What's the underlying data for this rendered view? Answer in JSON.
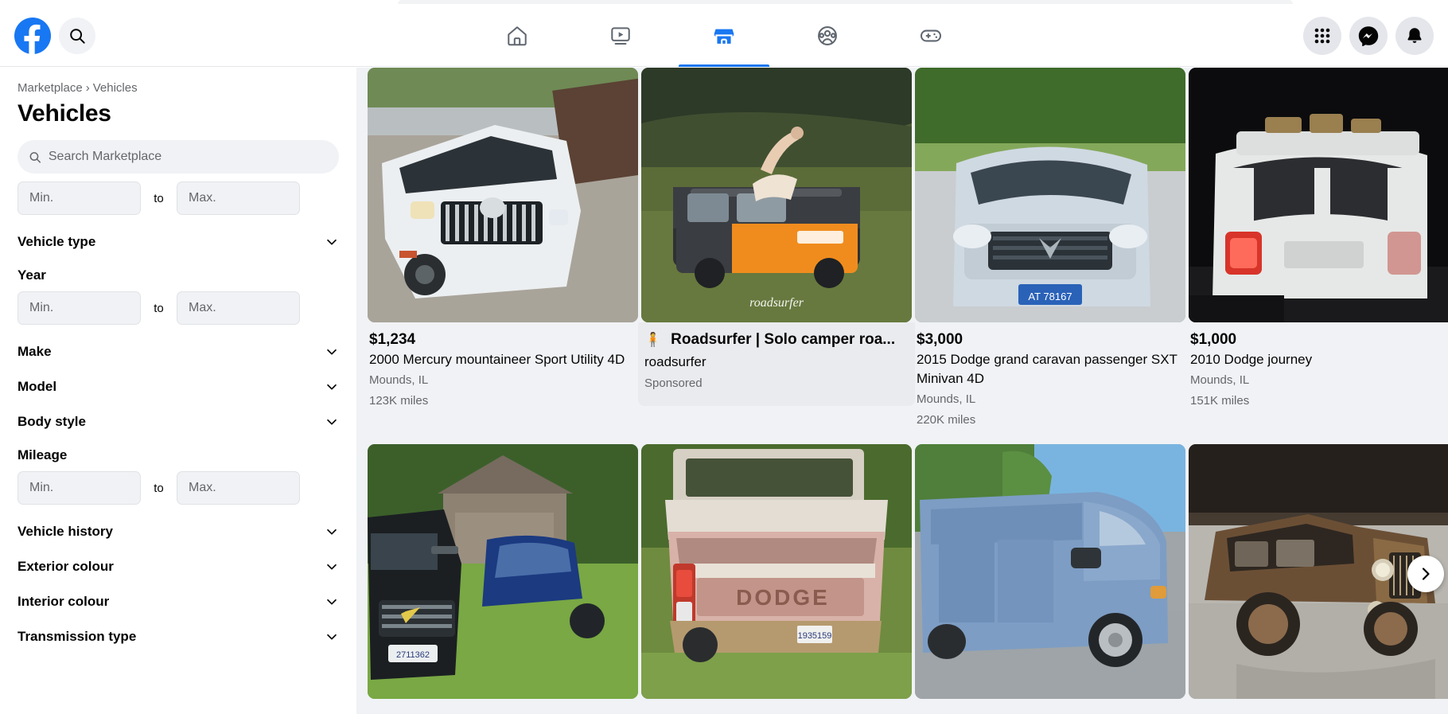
{
  "browser": {
    "tab_strip": ""
  },
  "topnav": {
    "logo": "facebook-logo",
    "search_icon": "search-icon",
    "tabs": [
      {
        "name": "home",
        "icon": "home-icon",
        "active": false
      },
      {
        "name": "video",
        "icon": "video-icon",
        "active": false
      },
      {
        "name": "marketplace",
        "icon": "marketplace-icon",
        "active": true
      },
      {
        "name": "groups",
        "icon": "groups-icon",
        "active": false
      },
      {
        "name": "gaming",
        "icon": "gaming-icon",
        "active": false
      }
    ],
    "right_buttons": [
      {
        "name": "menu",
        "icon": "grid-menu-icon"
      },
      {
        "name": "messenger",
        "icon": "messenger-icon"
      },
      {
        "name": "notifications",
        "icon": "bell-icon"
      }
    ]
  },
  "sidebar": {
    "breadcrumb": {
      "root": "Marketplace",
      "separator": "›",
      "current": "Vehicles"
    },
    "title": "Vehicles",
    "search": {
      "placeholder": "Search Marketplace",
      "value": "",
      "icon": "search-icon"
    },
    "range_to_label": "to",
    "min_placeholder": "Min.",
    "max_placeholder": "Max.",
    "price_range": {
      "min": "",
      "max": ""
    },
    "filters": [
      {
        "label": "Vehicle type",
        "type": "collapsible",
        "icon": "chevron-down-icon"
      },
      {
        "label": "Year",
        "type": "range"
      },
      {
        "label": "Make",
        "type": "collapsible",
        "icon": "chevron-down-icon"
      },
      {
        "label": "Model",
        "type": "collapsible",
        "icon": "chevron-down-icon"
      },
      {
        "label": "Body style",
        "type": "collapsible",
        "icon": "chevron-down-icon"
      },
      {
        "label": "Mileage",
        "type": "range"
      },
      {
        "label": "Vehicle history",
        "type": "collapsible",
        "icon": "chevron-down-icon"
      },
      {
        "label": "Exterior colour",
        "type": "collapsible",
        "icon": "chevron-down-icon"
      },
      {
        "label": "Interior colour",
        "type": "collapsible",
        "icon": "chevron-down-icon"
      },
      {
        "label": "Transmission type",
        "type": "collapsible",
        "icon": "chevron-down-icon"
      }
    ],
    "year_range": {
      "min": "",
      "max": ""
    },
    "mileage_range": {
      "min": "",
      "max": ""
    }
  },
  "listings": {
    "row1": [
      {
        "sponsored": false,
        "price": "$1,234",
        "title": "2000 Mercury mountaineer Sport Utility 4D",
        "location": "Mounds, IL",
        "mileage": "123K miles",
        "photo": "white-suv-on-gravel"
      },
      {
        "sponsored": true,
        "title": "Roadsurfer | Solo camper roa...",
        "emoji": "🧍",
        "brand": "roadsurfer",
        "label": "Sponsored",
        "photo": "orange-camper-van-in-field",
        "watermark": "roadsurfer"
      },
      {
        "sponsored": false,
        "price": "$3,000",
        "title": "2015 Dodge grand caravan passenger SXT Minivan 4D",
        "location": "Mounds, IL",
        "mileage": "220K miles",
        "photo": "silver-minivan-front",
        "plate": "AT 78167"
      },
      {
        "sponsored": false,
        "price": "$1,000",
        "title": "2010 Dodge journey",
        "location": "Mounds, IL",
        "mileage": "151K miles",
        "photo": "white-suv-rear-at-night"
      }
    ],
    "row2": [
      {
        "photo": "black-truck-and-blue-sedan-on-grass",
        "plate": "2711362"
      },
      {
        "photo": "old-dodge-pickup-rear",
        "badge_text": "DODGE",
        "plate": "1935159"
      },
      {
        "photo": "blue-cargo-van"
      },
      {
        "photo": "vintage-brown-rolls-royce"
      }
    ],
    "carousel_next_icon": "chevron-right-icon"
  },
  "colors": {
    "brand": "#1877f2",
    "page_bg": "#f0f2f5",
    "card_text": "#050505",
    "muted_text": "#65676b"
  }
}
